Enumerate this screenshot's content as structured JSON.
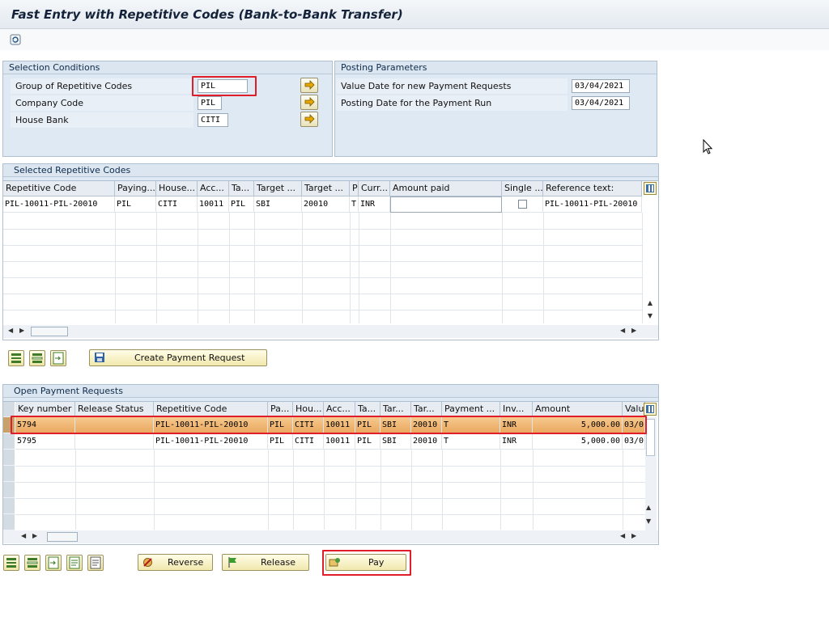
{
  "window": {
    "title": "Fast Entry with Repetitive Codes (Bank-to-Bank Transfer)"
  },
  "selection": {
    "header": "Selection Conditions",
    "fields": [
      {
        "label": "Group of Repetitive Codes",
        "value": "PIL"
      },
      {
        "label": "Company Code",
        "value": "PIL"
      },
      {
        "label": "House Bank",
        "value": "CITI"
      }
    ]
  },
  "posting": {
    "header": "Posting Parameters",
    "fields": [
      {
        "label": "Value Date for new Payment Requests",
        "value": "03/04/2021"
      },
      {
        "label": "Posting Date for the Payment Run",
        "value": "03/04/2021"
      }
    ]
  },
  "selected": {
    "header": "Selected Repetitive Codes",
    "columns": [
      "Repetitive Code",
      "Paying...",
      "House...",
      "Acc...",
      "Ta...",
      "Target ...",
      "Target ...",
      "P",
      "Curr...",
      "Amount paid",
      "Single ...",
      "Reference text:"
    ],
    "row": [
      "PIL-10011-PIL-20010",
      "PIL",
      "CITI",
      "10011",
      "PIL",
      "SBI",
      "20010",
      "T",
      "INR",
      "",
      "",
      "PIL-10011-PIL-20010"
    ]
  },
  "create_button": "Create Payment Request",
  "open": {
    "header": "Open Payment Requests",
    "columns": [
      "Key number",
      "Release Status",
      "Repetitive Code",
      "Pa...",
      "Hou...",
      "Acc...",
      "Ta...",
      "Tar...",
      "Tar...",
      "Payment ...",
      "Inv...",
      "Amount",
      "Valu"
    ],
    "rows": [
      [
        "5794",
        "",
        "PIL-10011-PIL-20010",
        "PIL",
        "CITI",
        "10011",
        "PIL",
        "SBI",
        "20010",
        "T",
        "INR",
        "5,000.00",
        "03/0"
      ],
      [
        "5795",
        "",
        "PIL-10011-PIL-20010",
        "PIL",
        "CITI",
        "10011",
        "PIL",
        "SBI",
        "20010",
        "T",
        "INR",
        "5,000.00",
        "03/0"
      ]
    ]
  },
  "actions": {
    "reverse": "Reverse",
    "release": "Release",
    "pay": "Pay"
  },
  "colors": {
    "highlight": "#e11d2a",
    "selected_row": "#eaa65d",
    "panel": "#dfe9f3"
  }
}
